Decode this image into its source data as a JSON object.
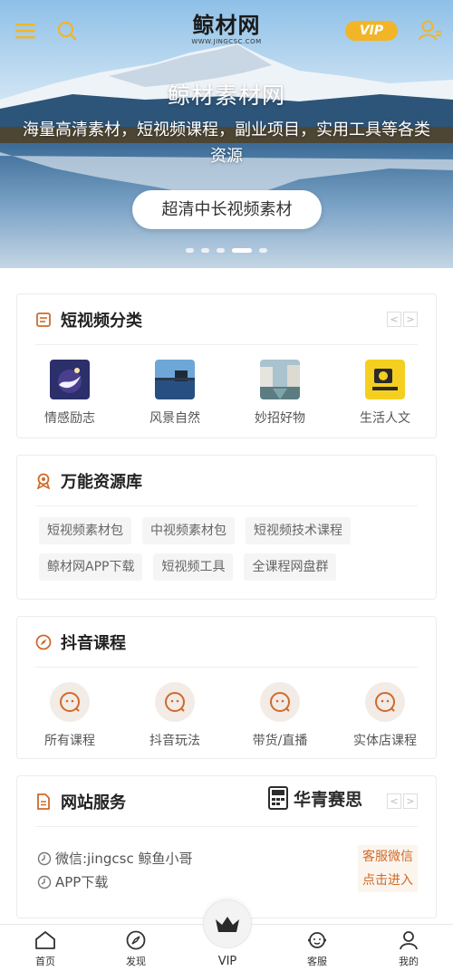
{
  "header": {
    "logo_title": "鲸材网",
    "logo_subtitle": "WWW.JINGCSC.COM",
    "vip_label": "VIP",
    "icons": [
      "menu-icon",
      "search-icon",
      "user-icon"
    ],
    "accent_color": "#f2b527"
  },
  "hero": {
    "title": "鲸材素材网",
    "description": "海量高清素材，短视频课程，副业项目，实用工具等各类资源",
    "cta": "超清中长视频素材",
    "slides_total": 5,
    "active_slide": 4
  },
  "short_video": {
    "title": "短视频分类",
    "pager_prev": "<",
    "pager_next": ">",
    "items": [
      {
        "label": "情感励志"
      },
      {
        "label": "风景自然"
      },
      {
        "label": "妙招好物"
      },
      {
        "label": "生活人文"
      }
    ]
  },
  "resources": {
    "title": "万能资源库",
    "rows": [
      [
        "短视频素材包",
        "中视频素材包",
        "短视频技术课程"
      ],
      [
        "鲸材网APP下载",
        "短视频工具",
        "全课程网盘群"
      ]
    ]
  },
  "douyin": {
    "title": "抖音课程",
    "items": [
      {
        "label": "所有课程"
      },
      {
        "label": "抖音玩法"
      },
      {
        "label": "带货/直播"
      },
      {
        "label": "实体店课程"
      }
    ]
  },
  "services": {
    "title": "网站服务",
    "wechat_line": "微信:jingcsc 鲸鱼小哥",
    "app_line": "APP下载",
    "wechat_button": "客服微信",
    "app_button": "点击进入",
    "pager_prev": "<",
    "pager_next": ">"
  },
  "watermark": {
    "text": "华青赛思"
  },
  "bottom_nav": {
    "home": "首页",
    "discover": "发现",
    "vip": "VIP",
    "service": "客服",
    "mine": "我的"
  },
  "colors": {
    "orange": "#d06a2a",
    "card_border": "#ececec"
  }
}
